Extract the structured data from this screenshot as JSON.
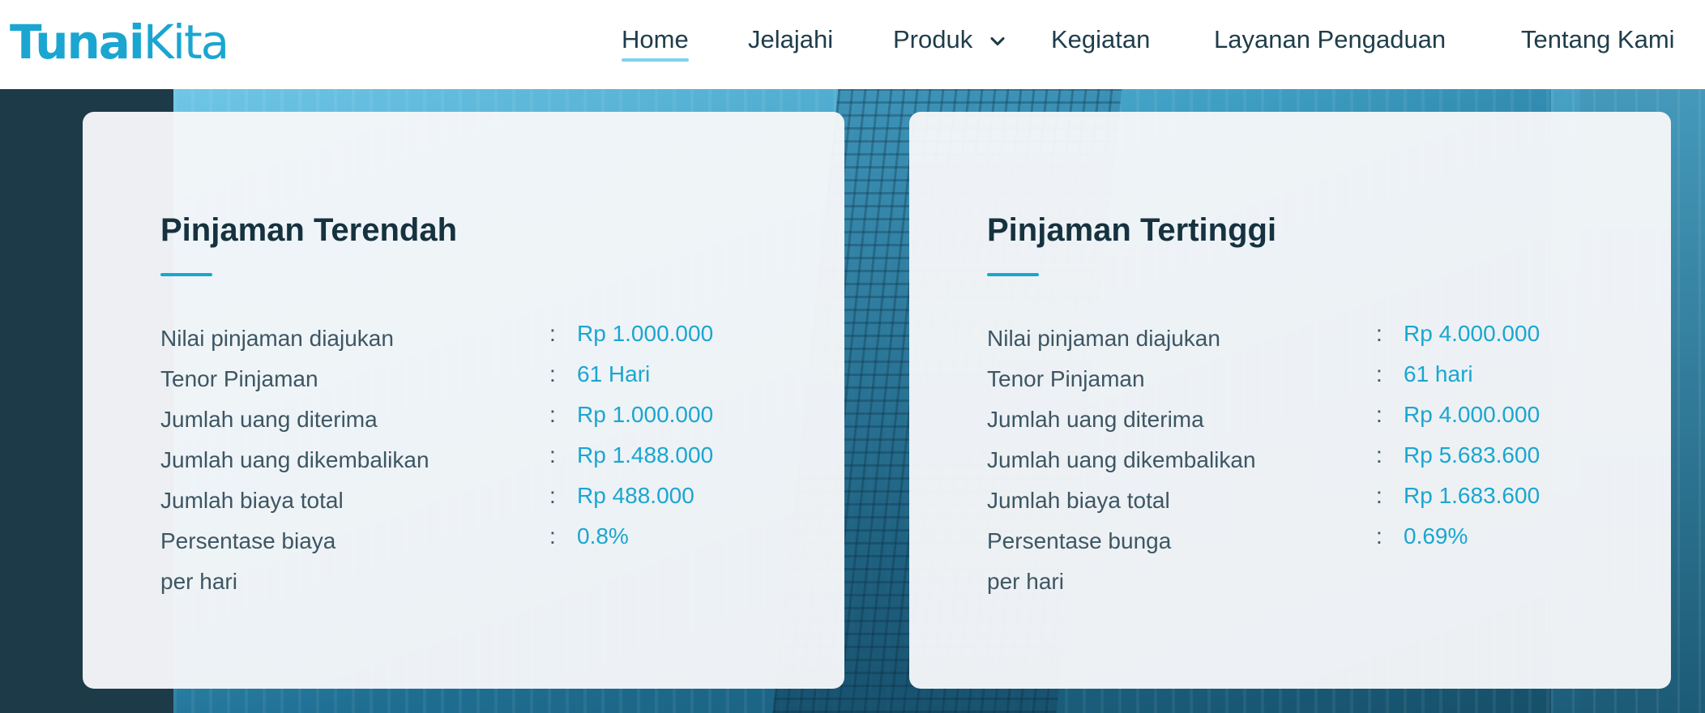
{
  "header": {
    "logo": {
      "part1": "Tunai",
      "part2": "Kita"
    },
    "nav": {
      "home": "Home",
      "jelajahi": "Jelajahi",
      "produk": "Produk",
      "kegiatan": "Kegiatan",
      "layanan": "Layanan Pengaduan",
      "tentang": "Tentang Kami"
    },
    "active_nav": "Home"
  },
  "cards": [
    {
      "title": "Pinjaman Terendah",
      "rows": [
        {
          "label": "Nilai pinjaman diajukan",
          "value": "Rp 1.000.000"
        },
        {
          "label": "Tenor Pinjaman",
          "value": "61 Hari"
        },
        {
          "label": "Jumlah uang diterima",
          "value": "Rp 1.000.000"
        },
        {
          "label": "Jumlah uang dikembalikan",
          "value": "Rp 1.488.000"
        },
        {
          "label": "Jumlah biaya total",
          "value": "Rp 488.000"
        },
        {
          "label": "Persentase biaya",
          "label_cont": "per hari",
          "value": "0.8%"
        }
      ]
    },
    {
      "title": "Pinjaman Tertinggi",
      "rows": [
        {
          "label": "Nilai pinjaman diajukan",
          "value": "Rp 4.000.000"
        },
        {
          "label": "Tenor Pinjaman",
          "value": "61 hari"
        },
        {
          "label": "Jumlah uang diterima",
          "value": "Rp 4.000.000"
        },
        {
          "label": "Jumlah uang dikembalikan",
          "value": "Rp 5.683.600"
        },
        {
          "label": "Jumlah biaya total",
          "value": "Rp 1.683.600"
        },
        {
          "label": "Persentase bunga",
          "label_cont": "per hari",
          "value": "0.69%"
        }
      ]
    }
  ],
  "separator": ":",
  "colors": {
    "brand": "#1aa6d0",
    "heading": "#16323f",
    "body_text": "#3d5663",
    "nav_text": "#1f3d4b",
    "nav_underline": "#7fd3ea"
  },
  "icons": {
    "produk_dropdown": "chevron-down-icon"
  }
}
